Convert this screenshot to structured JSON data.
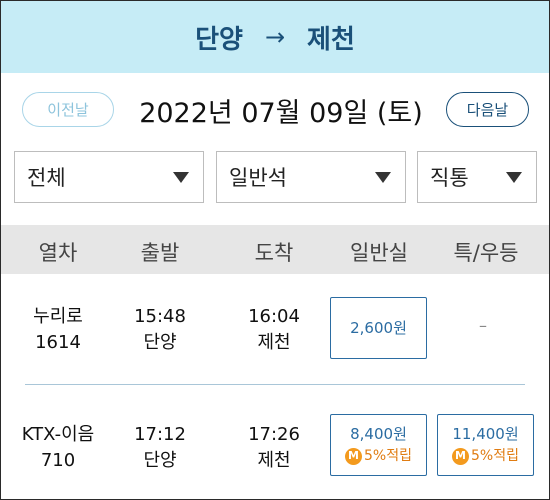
{
  "header": {
    "origin": "단양",
    "arrow": "→",
    "destination": "제천"
  },
  "date_nav": {
    "prev_label": "이전날",
    "date": "2022년 07월 09일 (토)",
    "next_label": "다음날"
  },
  "filters": {
    "train_type": "전체",
    "seat_class": "일반석",
    "route_type": "직통"
  },
  "table_headers": {
    "train": "열차",
    "depart": "출발",
    "arrive": "도착",
    "general": "일반실",
    "special": "특/우등"
  },
  "trains": [
    {
      "name": "누리로",
      "number": "1614",
      "depart_time": "15:48",
      "depart_station": "단양",
      "arrive_time": "16:04",
      "arrive_station": "제천",
      "general_price": "2,600원",
      "special_price": "–"
    },
    {
      "name": "KTX-이음",
      "number": "710",
      "depart_time": "17:12",
      "depart_station": "단양",
      "arrive_time": "17:26",
      "arrive_station": "제천",
      "general_price": "8,400원",
      "general_mileage": "5%적립",
      "special_price": "11,400원",
      "special_mileage": "5%적립",
      "mileage_badge": "M"
    }
  ],
  "colors": {
    "header_bg": "#c6ecf6",
    "primary": "#1a5079",
    "price_border": "#2b6ca2",
    "mileage": "#e07c12"
  }
}
